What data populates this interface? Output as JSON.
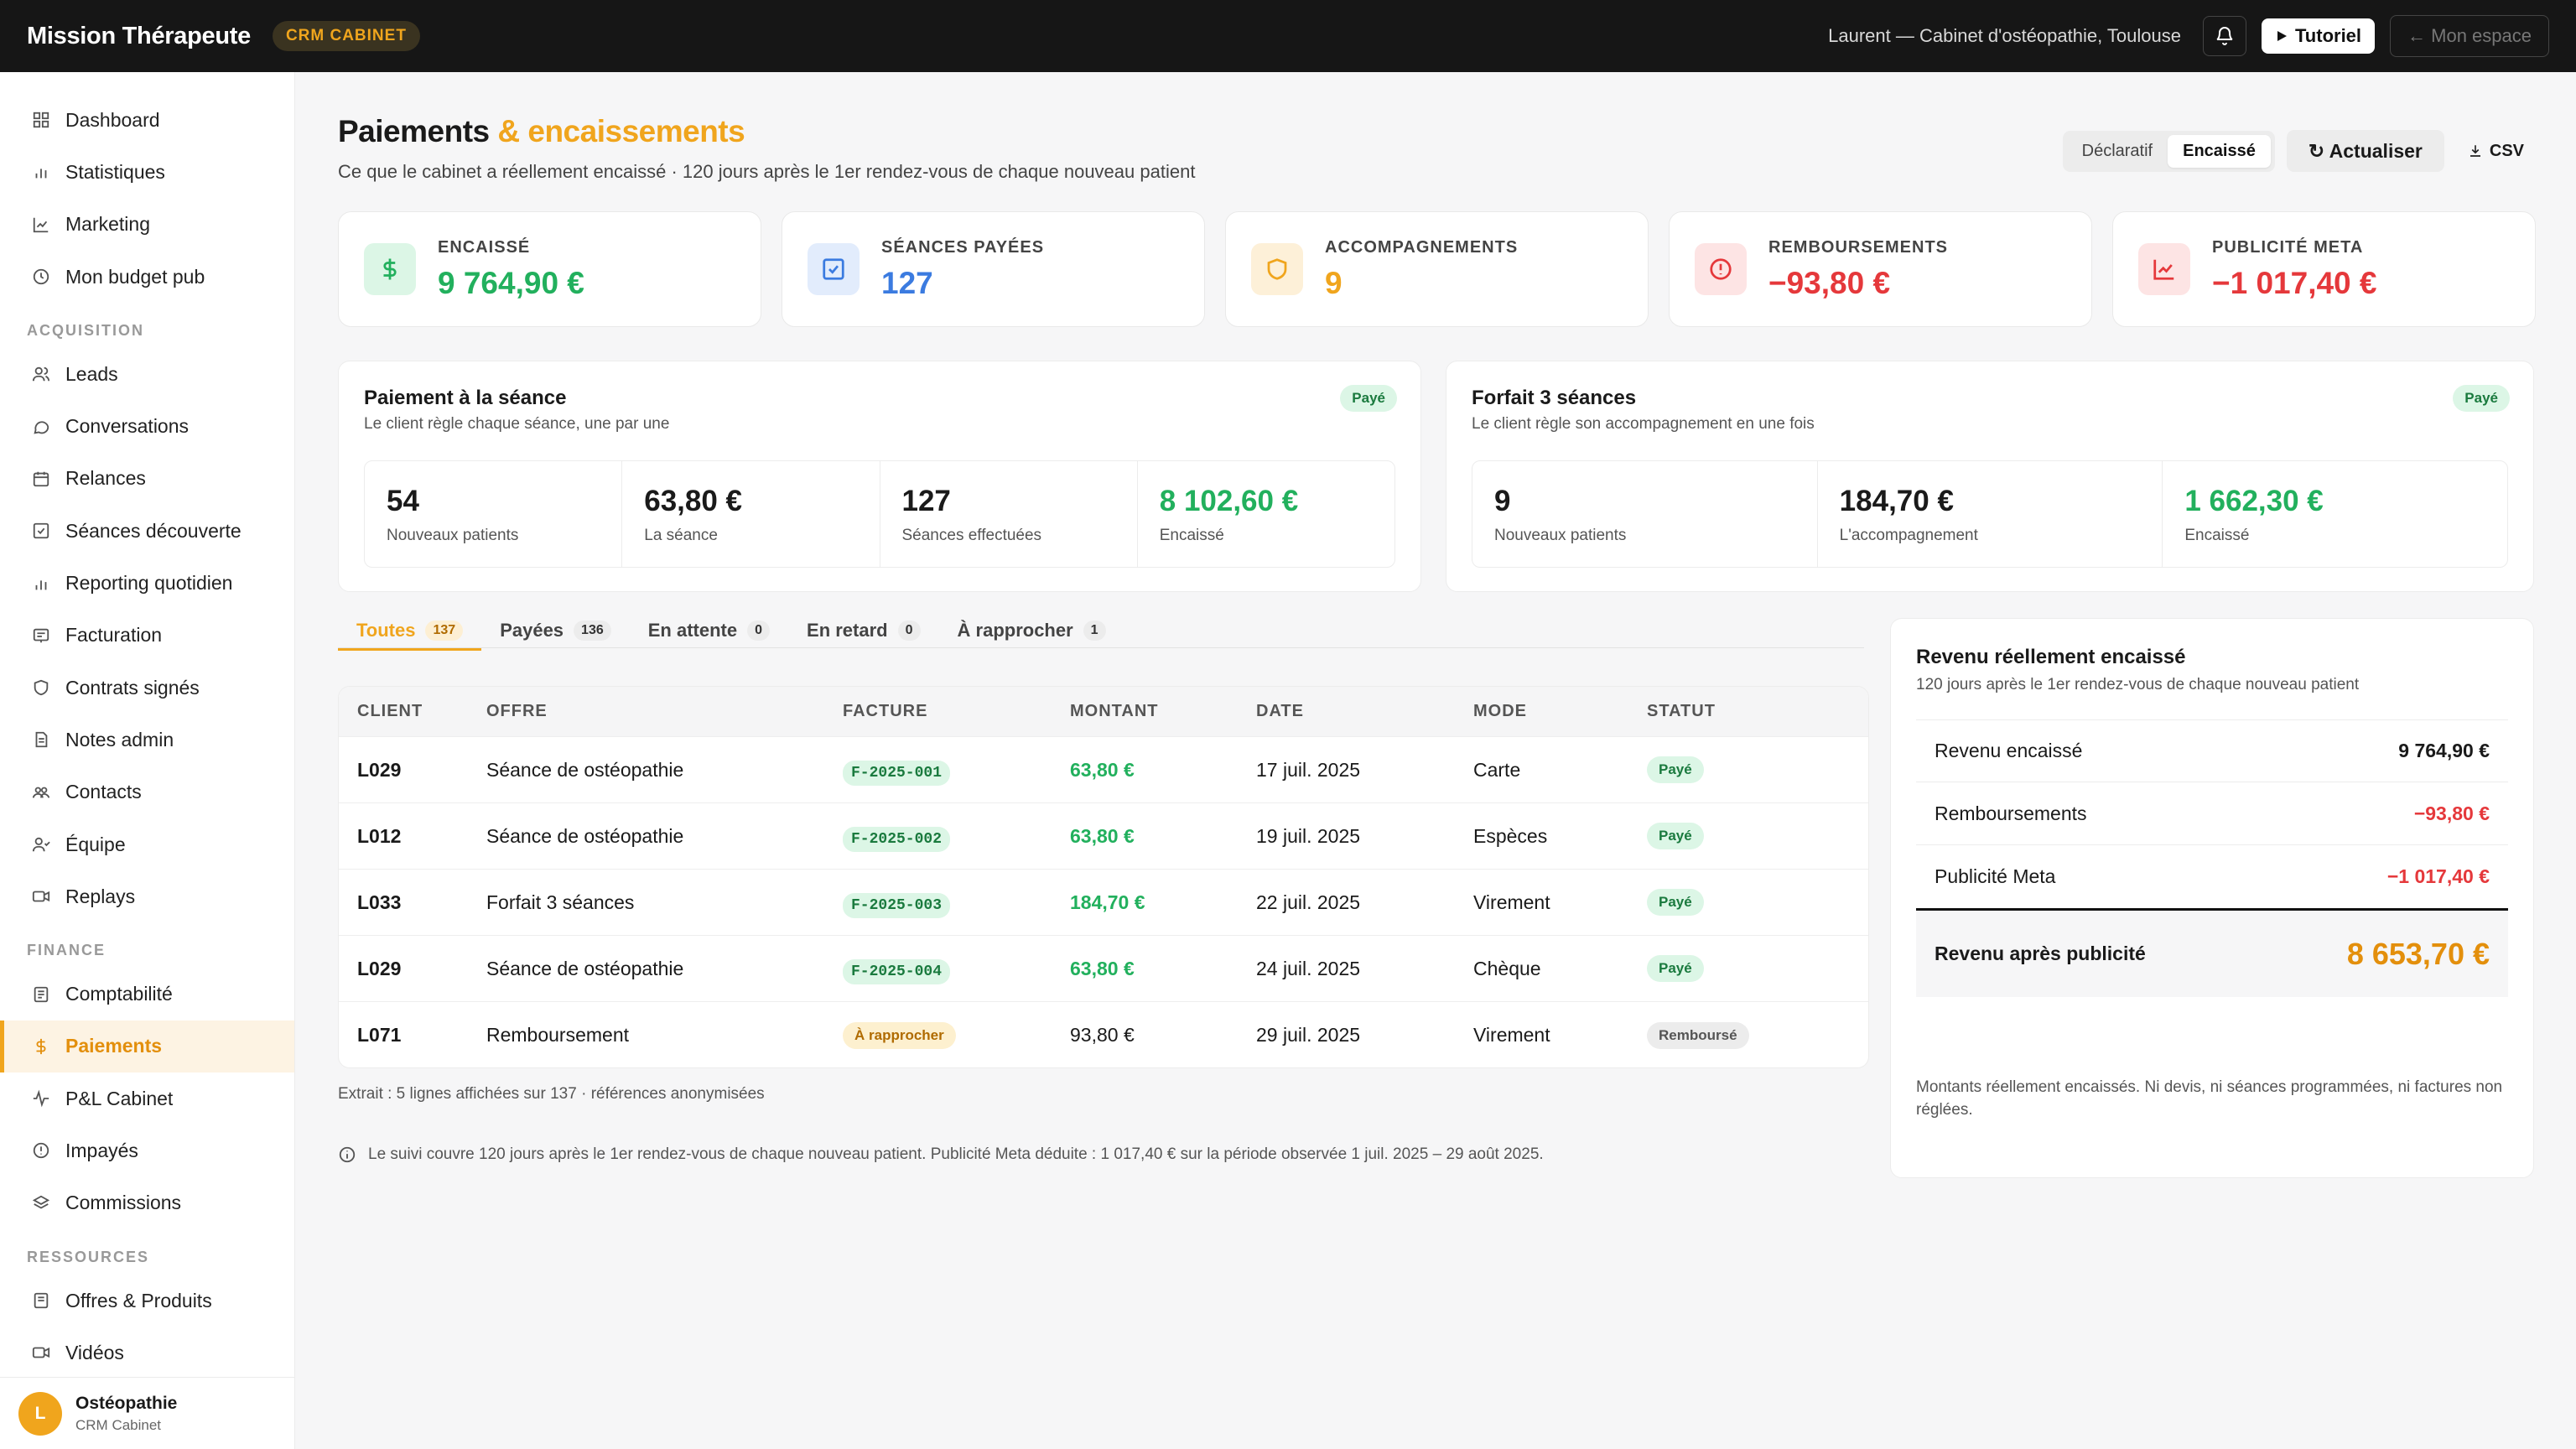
{
  "topbar": {
    "brand": "Mission Thérapeute",
    "badge": "CRM CABINET",
    "user": "Laurent — Cabinet d'ostéopathie, Toulouse",
    "tutorial": "Tutoriel",
    "my_space": "← Mon espace"
  },
  "sidebar": {
    "items": [
      {
        "label": "Dashboard",
        "icon": "grid-icon"
      },
      {
        "label": "Statistiques",
        "icon": "bar-chart-icon"
      },
      {
        "label": "Marketing",
        "icon": "line-chart-icon"
      },
      {
        "label": "Mon budget pub",
        "icon": "clock-icon"
      }
    ],
    "section_acquisition": "ACQUISITION",
    "acquisition": [
      {
        "label": "Leads",
        "icon": "users-icon"
      },
      {
        "label": "Conversations",
        "icon": "chat-icon"
      },
      {
        "label": "Relances",
        "icon": "calendar-icon"
      },
      {
        "label": "Séances découverte",
        "icon": "check-square-icon"
      },
      {
        "label": "Reporting quotidien",
        "icon": "bar-chart-icon"
      },
      {
        "label": "Facturation",
        "icon": "invoice-icon"
      },
      {
        "label": "Contrats signés",
        "icon": "shield-icon"
      },
      {
        "label": "Notes admin",
        "icon": "document-icon"
      },
      {
        "label": "Contacts",
        "icon": "contacts-icon"
      },
      {
        "label": "Équipe",
        "icon": "team-icon"
      },
      {
        "label": "Replays",
        "icon": "video-icon"
      }
    ],
    "section_finance": "FINANCE",
    "finance": [
      {
        "label": "Comptabilité",
        "icon": "ledger-icon"
      },
      {
        "label": "Paiements",
        "icon": "dollar-icon"
      },
      {
        "label": "P&L Cabinet",
        "icon": "pulse-icon"
      },
      {
        "label": "Impayés",
        "icon": "alert-circle-icon"
      },
      {
        "label": "Commissions",
        "icon": "layers-icon"
      }
    ],
    "section_resources": "RESSOURCES",
    "resources": [
      {
        "label": "Offres & Produits",
        "icon": "box-icon"
      },
      {
        "label": "Vidéos",
        "icon": "video-icon"
      }
    ],
    "footer": {
      "avatar": "L",
      "name": "Ostéopathie",
      "sub": "CRM Cabinet"
    }
  },
  "header": {
    "title_main": "Paiements",
    "title_accent": "& encaissements",
    "subtitle": "Ce que le cabinet a réellement encaissé · 120 jours après le 1er rendez-vous de chaque nouveau patient",
    "toggle_declaratif": "Déclaratif",
    "toggle_encaisse": "Encaissé",
    "refresh": "↻ Actualiser",
    "csv": "CSV"
  },
  "kpis": [
    {
      "label": "ENCAISSÉ",
      "value": "9 764,90 €",
      "color": "#22b05d",
      "icon": "dollar-icon"
    },
    {
      "label": "SÉANCES PAYÉES",
      "value": "127",
      "color": "#3b7be0",
      "icon": "check-square-icon"
    },
    {
      "label": "ACCOMPAGNEMENTS",
      "value": "9",
      "color": "#f0a51d",
      "icon": "shield-icon"
    },
    {
      "label": "REMBOURSEMENTS",
      "value": "−93,80 €",
      "color": "#e5383b",
      "icon": "alert-circle-icon"
    },
    {
      "label": "PUBLICITÉ META",
      "value": "−1 017,40 €",
      "color": "#e5383b",
      "icon": "line-chart-icon"
    }
  ],
  "offers": [
    {
      "title": "Paiement à la séance",
      "subtitle": "Le client règle chaque séance, une par une",
      "status": "Payé",
      "stats": [
        {
          "value": "54",
          "label": "Nouveaux patients"
        },
        {
          "value": "63,80 €",
          "label": "La séance"
        },
        {
          "value": "127",
          "label": "Séances effectuées"
        },
        {
          "value": "8 102,60 €",
          "label": "Encaissé"
        }
      ]
    },
    {
      "title": "Forfait 3 séances",
      "subtitle": "Le client règle son accompagnement en une fois",
      "status": "Payé",
      "stats": [
        {
          "value": "9",
          "label": "Nouveaux patients"
        },
        {
          "value": "184,70 €",
          "label": "L'accompagnement"
        },
        {
          "value": "1 662,30 €",
          "label": "Encaissé"
        }
      ]
    }
  ],
  "tabs": [
    {
      "label": "Toutes",
      "count": "137"
    },
    {
      "label": "Payées",
      "count": "136"
    },
    {
      "label": "En attente",
      "count": "0"
    },
    {
      "label": "En retard",
      "count": "0"
    },
    {
      "label": "À rapprocher",
      "count": "1"
    }
  ],
  "table": {
    "headers": [
      "CLIENT",
      "OFFRE",
      "FACTURE",
      "MONTANT",
      "DATE",
      "MODE",
      "STATUT"
    ],
    "rows": [
      {
        "client": "L029",
        "offer": "Séance de ostéopathie",
        "invoice": "F-2025-001",
        "amount": "63,80 €",
        "date": "17 juil. 2025",
        "mode": "Carte",
        "status": "Payé"
      },
      {
        "client": "L012",
        "offer": "Séance de ostéopathie",
        "invoice": "F-2025-002",
        "amount": "63,80 €",
        "date": "19 juil. 2025",
        "mode": "Espèces",
        "status": "Payé"
      },
      {
        "client": "L033",
        "offer": "Forfait 3 séances",
        "invoice": "F-2025-003",
        "amount": "184,70 €",
        "date": "22 juil. 2025",
        "mode": "Virement",
        "status": "Payé"
      },
      {
        "client": "L029",
        "offer": "Séance de ostéopathie",
        "invoice": "F-2025-004",
        "amount": "63,80 €",
        "date": "24 juil. 2025",
        "mode": "Chèque",
        "status": "Payé"
      },
      {
        "client": "L071",
        "offer": "Remboursement",
        "invoice": "À rapprocher",
        "amount": "93,80 €",
        "date": "29 juil. 2025",
        "mode": "Virement",
        "status": "Remboursé"
      }
    ],
    "extract": "Extrait : 5 lignes affichées sur 137 · références anonymisées"
  },
  "revenue": {
    "title": "Revenu réellement encaissé",
    "subtitle": "120 jours après le 1er rendez-vous de chaque nouveau patient",
    "rows": [
      {
        "label": "Revenu encaissé",
        "value": "9 764,90 €"
      },
      {
        "label": "Remboursements",
        "value": "−93,80 €"
      },
      {
        "label": "Publicité Meta",
        "value": "−1 017,40 €"
      }
    ],
    "total_label": "Revenu après publicité",
    "total_value": "8 653,70 €",
    "note": "Montants réellement encaissés. Ni devis, ni séances programmées, ni factures non réglées."
  },
  "footnote": "Le suivi couvre 120 jours après le 1er rendez-vous de chaque nouveau patient. Publicité Meta déduite : 1 017,40 € sur la période observée 1 juil. 2025 – 29 août 2025."
}
